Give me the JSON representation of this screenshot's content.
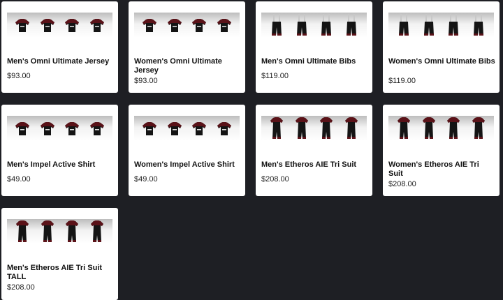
{
  "colors": {
    "page_bg": "#1e1f24",
    "card_bg": "#ffffff",
    "garment_black": "#141414",
    "garment_red": "#5a1218",
    "bib_strap": "#c8c8c8"
  },
  "products": [
    {
      "name": "Men's Omni Ultimate Jersey",
      "price": "$93.00",
      "image": "jersey"
    },
    {
      "name": "Women's Omni Ultimate Jersey",
      "price": "$93.00",
      "image": "jersey"
    },
    {
      "name": "Men's Omni Ultimate Bibs",
      "price": "$119.00",
      "image": "bibs"
    },
    {
      "name": "Women's Omni Ultimate Bibs",
      "price": "$119.00",
      "image": "bibs"
    },
    {
      "name": "Men's Impel Active Shirt",
      "price": "$49.00",
      "image": "jersey"
    },
    {
      "name": "Women's Impel Active Shirt",
      "price": "$49.00",
      "image": "jersey"
    },
    {
      "name": "Men's Etheros AIE Tri Suit",
      "price": "$208.00",
      "image": "trisuit"
    },
    {
      "name": "Women's Etheros AIE Tri Suit",
      "price": "$208.00",
      "image": "trisuit"
    },
    {
      "name": "Men's Etheros AIE Tri Suit TALL",
      "price": "$208.00",
      "image": "trisuit"
    }
  ]
}
